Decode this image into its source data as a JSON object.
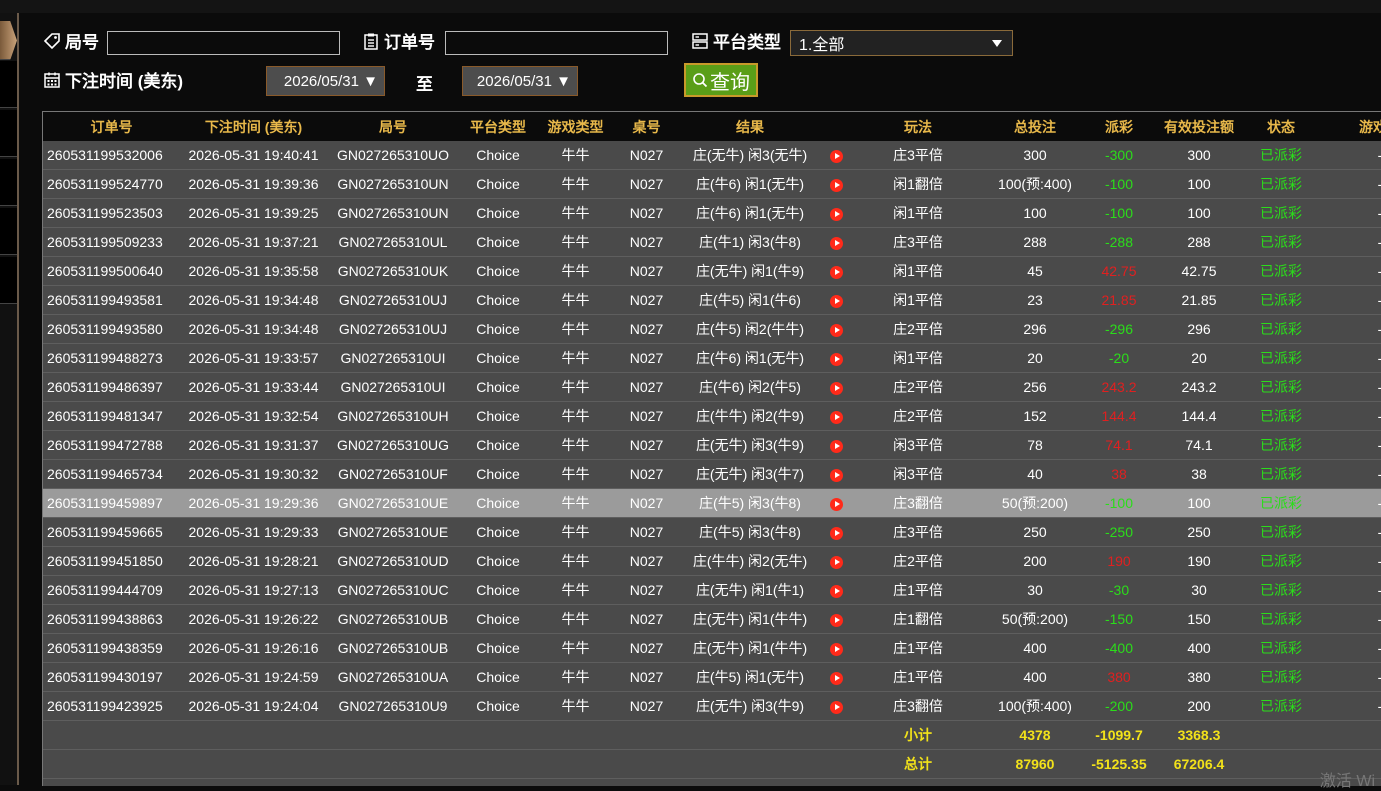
{
  "filters": {
    "game_no_label": "局号",
    "game_no_value": "",
    "order_no_label": "订单号",
    "order_no_value": "",
    "platform_label": "平台类型",
    "platform_selected": "1.全部",
    "time_label": "下注时间 (美东)",
    "start_date": "2026/05/31",
    "to_label": "至",
    "end_date": "2026/05/31",
    "query_label": "查询"
  },
  "table": {
    "headers": [
      "订单号",
      "下注时间 (美东)",
      "局号",
      "平台类型",
      "游戏类型",
      "桌号",
      "结果",
      "",
      "玩法",
      "总投注",
      "派彩",
      "有效投注额",
      "状态",
      "游戏模"
    ],
    "rows": [
      {
        "order": "260531199532006",
        "time": "2026-05-31 19:40:41",
        "game": "GN027265310UO",
        "platform": "Choice",
        "type": "牛牛",
        "table": "N027",
        "result": "庄(无牛) 闲3(无牛)",
        "play": "庄3平倍",
        "bet": "300",
        "payout": "-300",
        "pcolor": "g",
        "valid": "300",
        "status": "已派彩",
        "mode": "-"
      },
      {
        "order": "260531199524770",
        "time": "2026-05-31 19:39:36",
        "game": "GN027265310UN",
        "platform": "Choice",
        "type": "牛牛",
        "table": "N027",
        "result": "庄(牛6) 闲1(无牛)",
        "play": "闲1翻倍",
        "bet": "100(预:400)",
        "payout": "-100",
        "pcolor": "g",
        "valid": "100",
        "status": "已派彩",
        "mode": "-"
      },
      {
        "order": "260531199523503",
        "time": "2026-05-31 19:39:25",
        "game": "GN027265310UN",
        "platform": "Choice",
        "type": "牛牛",
        "table": "N027",
        "result": "庄(牛6) 闲1(无牛)",
        "play": "闲1平倍",
        "bet": "100",
        "payout": "-100",
        "pcolor": "g",
        "valid": "100",
        "status": "已派彩",
        "mode": "-"
      },
      {
        "order": "260531199509233",
        "time": "2026-05-31 19:37:21",
        "game": "GN027265310UL",
        "platform": "Choice",
        "type": "牛牛",
        "table": "N027",
        "result": "庄(牛1) 闲3(牛8)",
        "play": "庄3平倍",
        "bet": "288",
        "payout": "-288",
        "pcolor": "g",
        "valid": "288",
        "status": "已派彩",
        "mode": "-"
      },
      {
        "order": "260531199500640",
        "time": "2026-05-31 19:35:58",
        "game": "GN027265310UK",
        "platform": "Choice",
        "type": "牛牛",
        "table": "N027",
        "result": "庄(无牛) 闲1(牛9)",
        "play": "闲1平倍",
        "bet": "45",
        "payout": "42.75",
        "pcolor": "r",
        "valid": "42.75",
        "status": "已派彩",
        "mode": "-"
      },
      {
        "order": "260531199493581",
        "time": "2026-05-31 19:34:48",
        "game": "GN027265310UJ",
        "platform": "Choice",
        "type": "牛牛",
        "table": "N027",
        "result": "庄(牛5) 闲1(牛6)",
        "play": "闲1平倍",
        "bet": "23",
        "payout": "21.85",
        "pcolor": "r",
        "valid": "21.85",
        "status": "已派彩",
        "mode": "-"
      },
      {
        "order": "260531199493580",
        "time": "2026-05-31 19:34:48",
        "game": "GN027265310UJ",
        "platform": "Choice",
        "type": "牛牛",
        "table": "N027",
        "result": "庄(牛5) 闲2(牛牛)",
        "play": "庄2平倍",
        "bet": "296",
        "payout": "-296",
        "pcolor": "g",
        "valid": "296",
        "status": "已派彩",
        "mode": "-"
      },
      {
        "order": "260531199488273",
        "time": "2026-05-31 19:33:57",
        "game": "GN027265310UI",
        "platform": "Choice",
        "type": "牛牛",
        "table": "N027",
        "result": "庄(牛6) 闲1(无牛)",
        "play": "闲1平倍",
        "bet": "20",
        "payout": "-20",
        "pcolor": "g",
        "valid": "20",
        "status": "已派彩",
        "mode": "-"
      },
      {
        "order": "260531199486397",
        "time": "2026-05-31 19:33:44",
        "game": "GN027265310UI",
        "platform": "Choice",
        "type": "牛牛",
        "table": "N027",
        "result": "庄(牛6) 闲2(牛5)",
        "play": "庄2平倍",
        "bet": "256",
        "payout": "243.2",
        "pcolor": "r",
        "valid": "243.2",
        "status": "已派彩",
        "mode": "-"
      },
      {
        "order": "260531199481347",
        "time": "2026-05-31 19:32:54",
        "game": "GN027265310UH",
        "platform": "Choice",
        "type": "牛牛",
        "table": "N027",
        "result": "庄(牛牛) 闲2(牛9)",
        "play": "庄2平倍",
        "bet": "152",
        "payout": "144.4",
        "pcolor": "r",
        "valid": "144.4",
        "status": "已派彩",
        "mode": "-"
      },
      {
        "order": "260531199472788",
        "time": "2026-05-31 19:31:37",
        "game": "GN027265310UG",
        "platform": "Choice",
        "type": "牛牛",
        "table": "N027",
        "result": "庄(无牛) 闲3(牛9)",
        "play": "闲3平倍",
        "bet": "78",
        "payout": "74.1",
        "pcolor": "r",
        "valid": "74.1",
        "status": "已派彩",
        "mode": "-"
      },
      {
        "order": "260531199465734",
        "time": "2026-05-31 19:30:32",
        "game": "GN027265310UF",
        "platform": "Choice",
        "type": "牛牛",
        "table": "N027",
        "result": "庄(无牛) 闲3(牛7)",
        "play": "闲3平倍",
        "bet": "40",
        "payout": "38",
        "pcolor": "r",
        "valid": "38",
        "status": "已派彩",
        "mode": "-"
      },
      {
        "order": "260531199459897",
        "time": "2026-05-31 19:29:36",
        "game": "GN027265310UE",
        "platform": "Choice",
        "type": "牛牛",
        "table": "N027",
        "result": "庄(牛5) 闲3(牛8)",
        "play": "庄3翻倍",
        "bet": "50(预:200)",
        "payout": "-100",
        "pcolor": "g",
        "valid": "100",
        "status": "已派彩",
        "mode": "-",
        "selected": true
      },
      {
        "order": "260531199459665",
        "time": "2026-05-31 19:29:33",
        "game": "GN027265310UE",
        "platform": "Choice",
        "type": "牛牛",
        "table": "N027",
        "result": "庄(牛5) 闲3(牛8)",
        "play": "庄3平倍",
        "bet": "250",
        "payout": "-250",
        "pcolor": "g",
        "valid": "250",
        "status": "已派彩",
        "mode": "-"
      },
      {
        "order": "260531199451850",
        "time": "2026-05-31 19:28:21",
        "game": "GN027265310UD",
        "platform": "Choice",
        "type": "牛牛",
        "table": "N027",
        "result": "庄(牛牛) 闲2(无牛)",
        "play": "庄2平倍",
        "bet": "200",
        "payout": "190",
        "pcolor": "r",
        "valid": "190",
        "status": "已派彩",
        "mode": "-"
      },
      {
        "order": "260531199444709",
        "time": "2026-05-31 19:27:13",
        "game": "GN027265310UC",
        "platform": "Choice",
        "type": "牛牛",
        "table": "N027",
        "result": "庄(无牛) 闲1(牛1)",
        "play": "庄1平倍",
        "bet": "30",
        "payout": "-30",
        "pcolor": "g",
        "valid": "30",
        "status": "已派彩",
        "mode": "-"
      },
      {
        "order": "260531199438863",
        "time": "2026-05-31 19:26:22",
        "game": "GN027265310UB",
        "platform": "Choice",
        "type": "牛牛",
        "table": "N027",
        "result": "庄(无牛) 闲1(牛牛)",
        "play": "庄1翻倍",
        "bet": "50(预:200)",
        "payout": "-150",
        "pcolor": "g",
        "valid": "150",
        "status": "已派彩",
        "mode": "-"
      },
      {
        "order": "260531199438359",
        "time": "2026-05-31 19:26:16",
        "game": "GN027265310UB",
        "platform": "Choice",
        "type": "牛牛",
        "table": "N027",
        "result": "庄(无牛) 闲1(牛牛)",
        "play": "庄1平倍",
        "bet": "400",
        "payout": "-400",
        "pcolor": "g",
        "valid": "400",
        "status": "已派彩",
        "mode": "-"
      },
      {
        "order": "260531199430197",
        "time": "2026-05-31 19:24:59",
        "game": "GN027265310UA",
        "platform": "Choice",
        "type": "牛牛",
        "table": "N027",
        "result": "庄(牛5) 闲1(无牛)",
        "play": "庄1平倍",
        "bet": "400",
        "payout": "380",
        "pcolor": "r",
        "valid": "380",
        "status": "已派彩",
        "mode": "-"
      },
      {
        "order": "260531199423925",
        "time": "2026-05-31 19:24:04",
        "game": "GN027265310U9",
        "platform": "Choice",
        "type": "牛牛",
        "table": "N027",
        "result": "庄(无牛) 闲3(牛9)",
        "play": "庄3翻倍",
        "bet": "100(预:400)",
        "payout": "-200",
        "pcolor": "g",
        "valid": "200",
        "status": "已派彩",
        "mode": "-"
      }
    ],
    "subtotal": {
      "label": "小计",
      "bet": "4378",
      "payout": "-1099.7",
      "valid": "3368.3"
    },
    "total": {
      "label": "总计",
      "bet": "87960",
      "payout": "-5125.35",
      "valid": "67206.4"
    }
  },
  "colors": {
    "accent_gold": "#e8b84a",
    "win_red": "#e02020",
    "loss_green": "#2bdd1a",
    "query_green": "#5a9e18"
  },
  "watermark": "激活 Wi"
}
